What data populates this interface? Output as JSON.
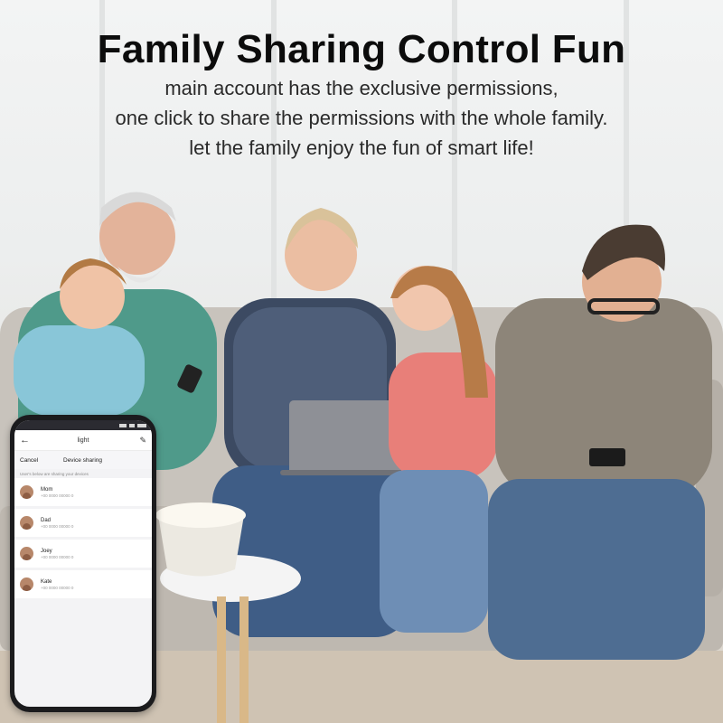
{
  "headline": {
    "title": "Family Sharing Control Fun",
    "lines": [
      "main account has the exclusive permissions,",
      "one click to share the permissions with the whole family.",
      "let the family enjoy the fun of smart life!"
    ]
  },
  "phone": {
    "topbar_title": "light",
    "cancel_label": "Cancel",
    "header_title": "Device sharing",
    "hint": "User's below are sharing your devices",
    "members": [
      {
        "name": "Mom",
        "number": "+00 0000 00000 0"
      },
      {
        "name": "Dad",
        "number": "+00 0000 00000 0"
      },
      {
        "name": "Joey",
        "number": "+00 0000 00000 0"
      },
      {
        "name": "Kate",
        "number": "+00 0000 00000 0"
      }
    ],
    "icons": {
      "back": "back-arrow-icon",
      "edit": "edit-pencil-icon"
    }
  },
  "colors": {
    "headline": "#0c0c0c",
    "phone_frame": "#1b1b1d",
    "phone_status": "#2b2b31"
  }
}
